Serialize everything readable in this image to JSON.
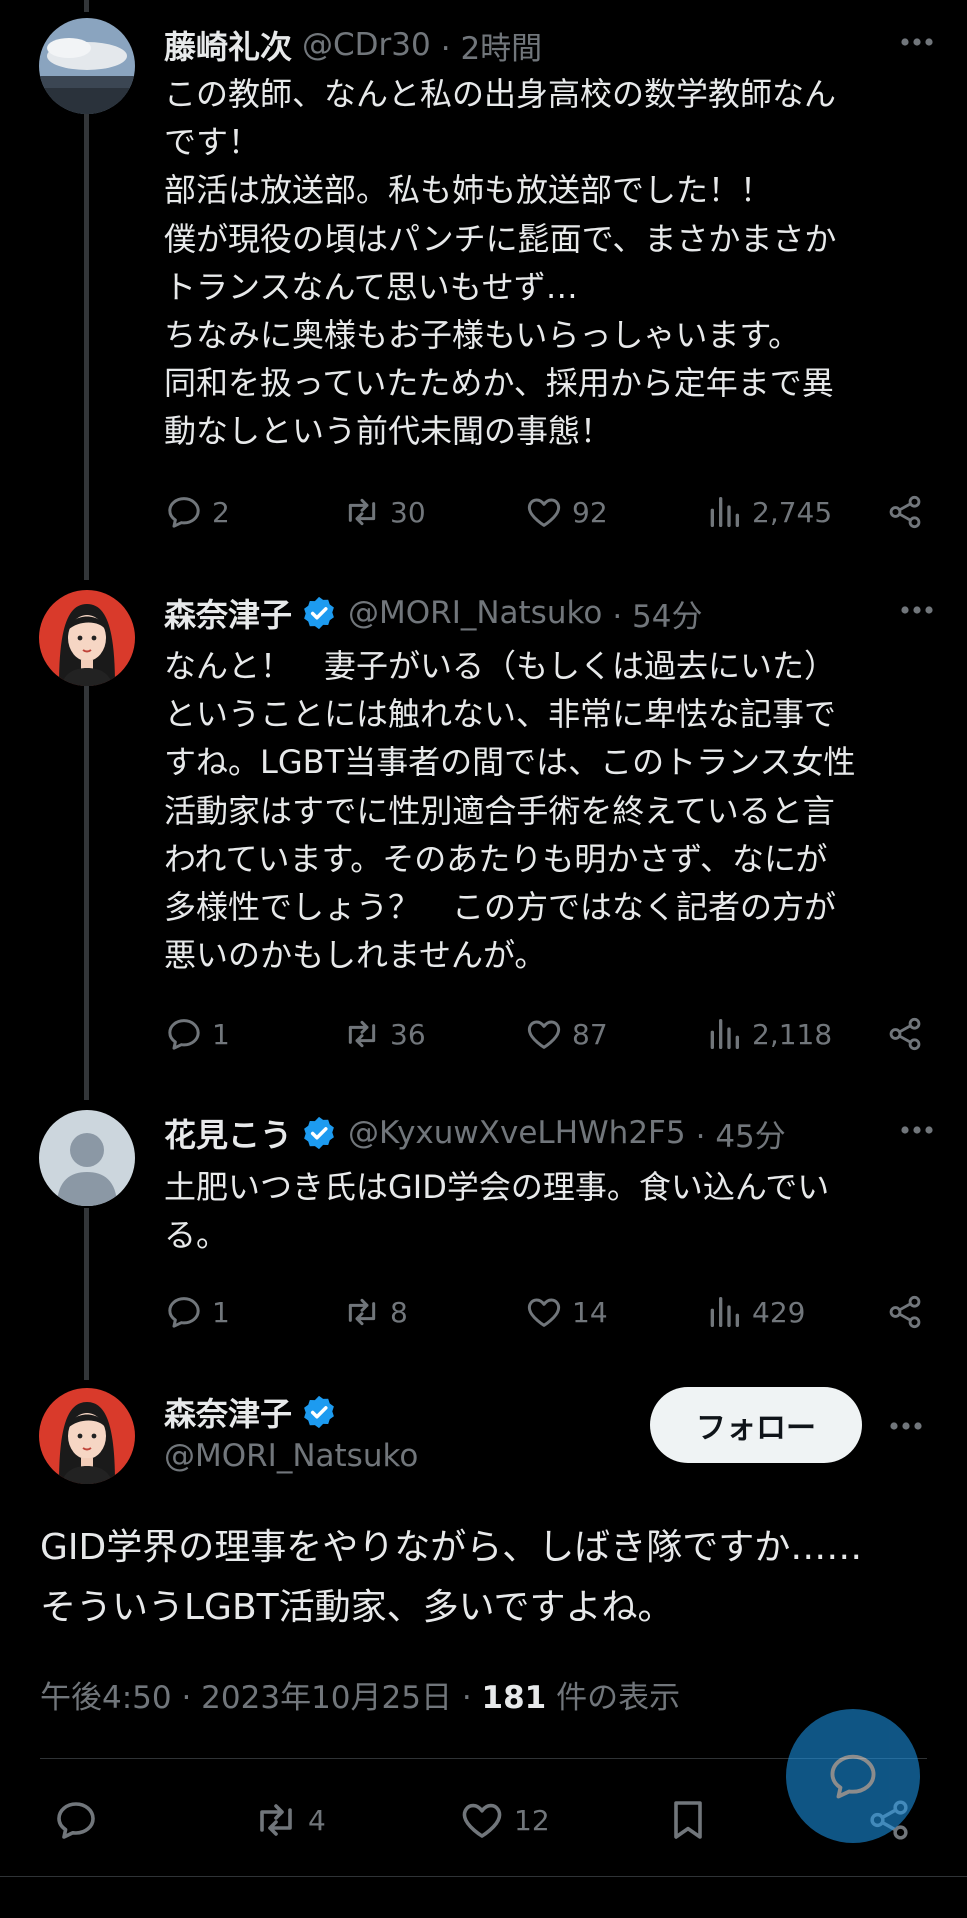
{
  "thread": [
    {
      "name": "藤崎礼次",
      "handle": "@CDr30",
      "time": "· 2時間",
      "verified": false,
      "avatar": "landscape-avatar",
      "text": "この教師、なんと私の出身高校の数学教師なん\nです！\n部活は放送部。私も姉も放送部でした！！\n僕が現役の頃はパンチに髭面で、まさかまさか\nトランスなんて思いもせず…\nちなみに奥様もお子様もいらっしゃいます。\n同和を扱っていたためか、採用から定年まで異\n動なしという前代未聞の事態！",
      "replies": "2",
      "reposts": "30",
      "likes": "92",
      "views": "2,745"
    },
    {
      "name": "森奈津子",
      "handle": "@MORI_Natsuko",
      "time": "· 54分",
      "verified": true,
      "avatar": "illustrated-woman-avatar",
      "text": "なんと！　妻子がいる（もしくは過去にいた）\nということには触れない、非常に卑怯な記事で\nすね。LGBT当事者の間では、このトランス女性\n活動家はすでに性別適合手術を終えていると言\nわれています。そのあたりも明かさず、なにが\n多様性でしょう？　この方ではなく記者の方が\n悪いのかもしれませんが。",
      "replies": "1",
      "reposts": "36",
      "likes": "87",
      "views": "2,118"
    },
    {
      "name": "花見こう",
      "handle": "@KyxuwXveLHWh2F5",
      "time": "· 45分",
      "verified": true,
      "avatar": "default-avatar",
      "text": "土肥いつき氏はGID学会の理事。食い込んでい\nる。",
      "replies": "1",
      "reposts": "8",
      "likes": "14",
      "views": "429"
    }
  ],
  "main": {
    "name": "森奈津子",
    "handle": "@MORI_Natsuko",
    "follow_label": "フォロー",
    "text": "GID学界の理事をやりながら、しばき隊ですか……\nそういうLGBT活動家、多いですよね。",
    "timestamp": "午後4:50 · 2023年10月25日 · ",
    "views_count": "181",
    "views_label": " 件の表示",
    "reposts": "4",
    "likes": "12"
  },
  "colors": {
    "background": "#000000",
    "text": "#e7e9ea",
    "muted": "#71767b",
    "verified": "#1d9bf0",
    "follow_button": "#eff3f4"
  }
}
